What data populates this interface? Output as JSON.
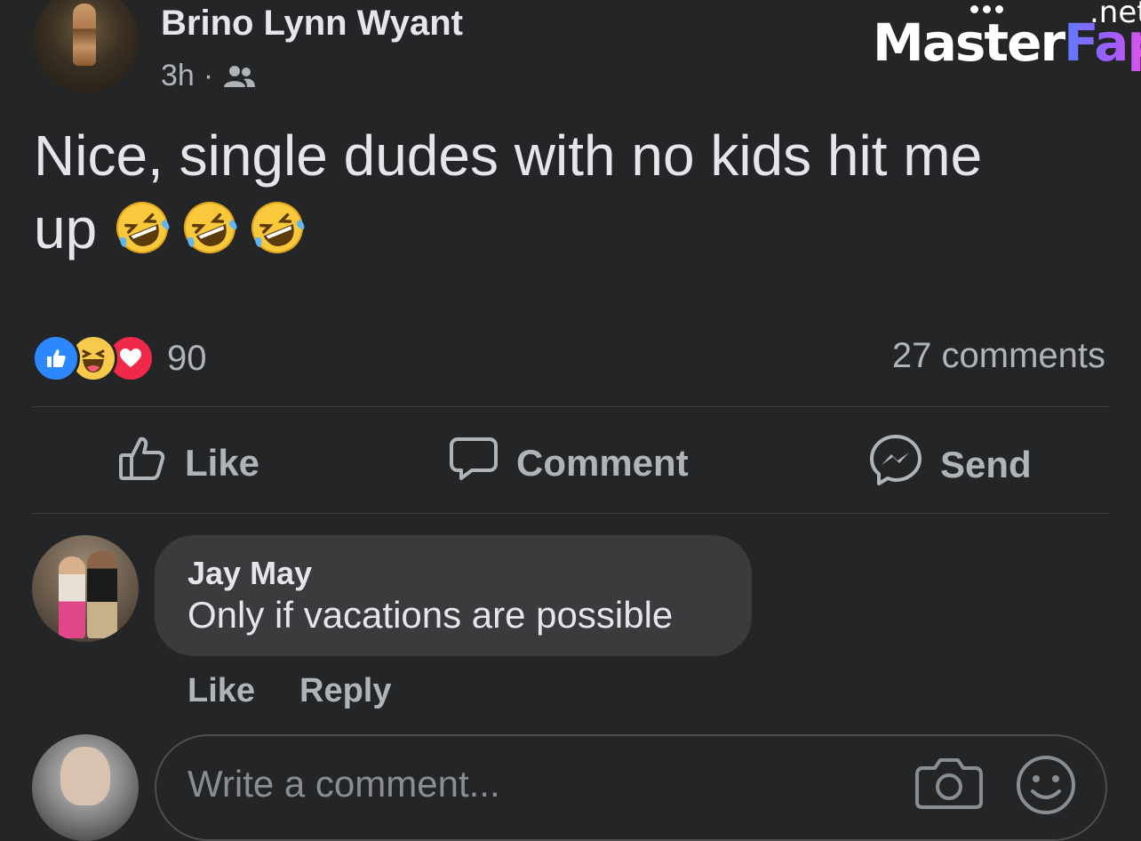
{
  "post": {
    "author": "Brino Lynn Wyant",
    "time": "3h",
    "separator": "·",
    "audience_icon": "friends-icon",
    "text": "Nice, single dudes with no kids hit me up",
    "emoji_icons": [
      "rolling-on-floor-laughing-emoji",
      "rolling-on-floor-laughing-emoji",
      "rolling-on-floor-laughing-emoji"
    ]
  },
  "watermark": {
    "part1": "Master",
    "part2": "Fap",
    "tld": ".net"
  },
  "reactions": {
    "icons": [
      "like-reaction-icon",
      "haha-reaction-icon",
      "love-reaction-icon"
    ],
    "count": "90",
    "comments": "27 comments"
  },
  "actions": {
    "like": "Like",
    "comment": "Comment",
    "send": "Send"
  },
  "comment": {
    "author": "Jay May",
    "text": "Only if vacations are possible",
    "like": "Like",
    "reply": "Reply"
  },
  "composer": {
    "placeholder": "Write a comment...",
    "icons": [
      "camera-icon",
      "emoji-icon"
    ]
  },
  "colors": {
    "background": "#242526",
    "bubble": "#3a3b3c",
    "text_primary": "#e4e6eb",
    "text_secondary": "#b0b3b8",
    "like_blue": "#2d88ff",
    "love_red": "#f0284a",
    "haha_yellow": "#f7c94c"
  }
}
